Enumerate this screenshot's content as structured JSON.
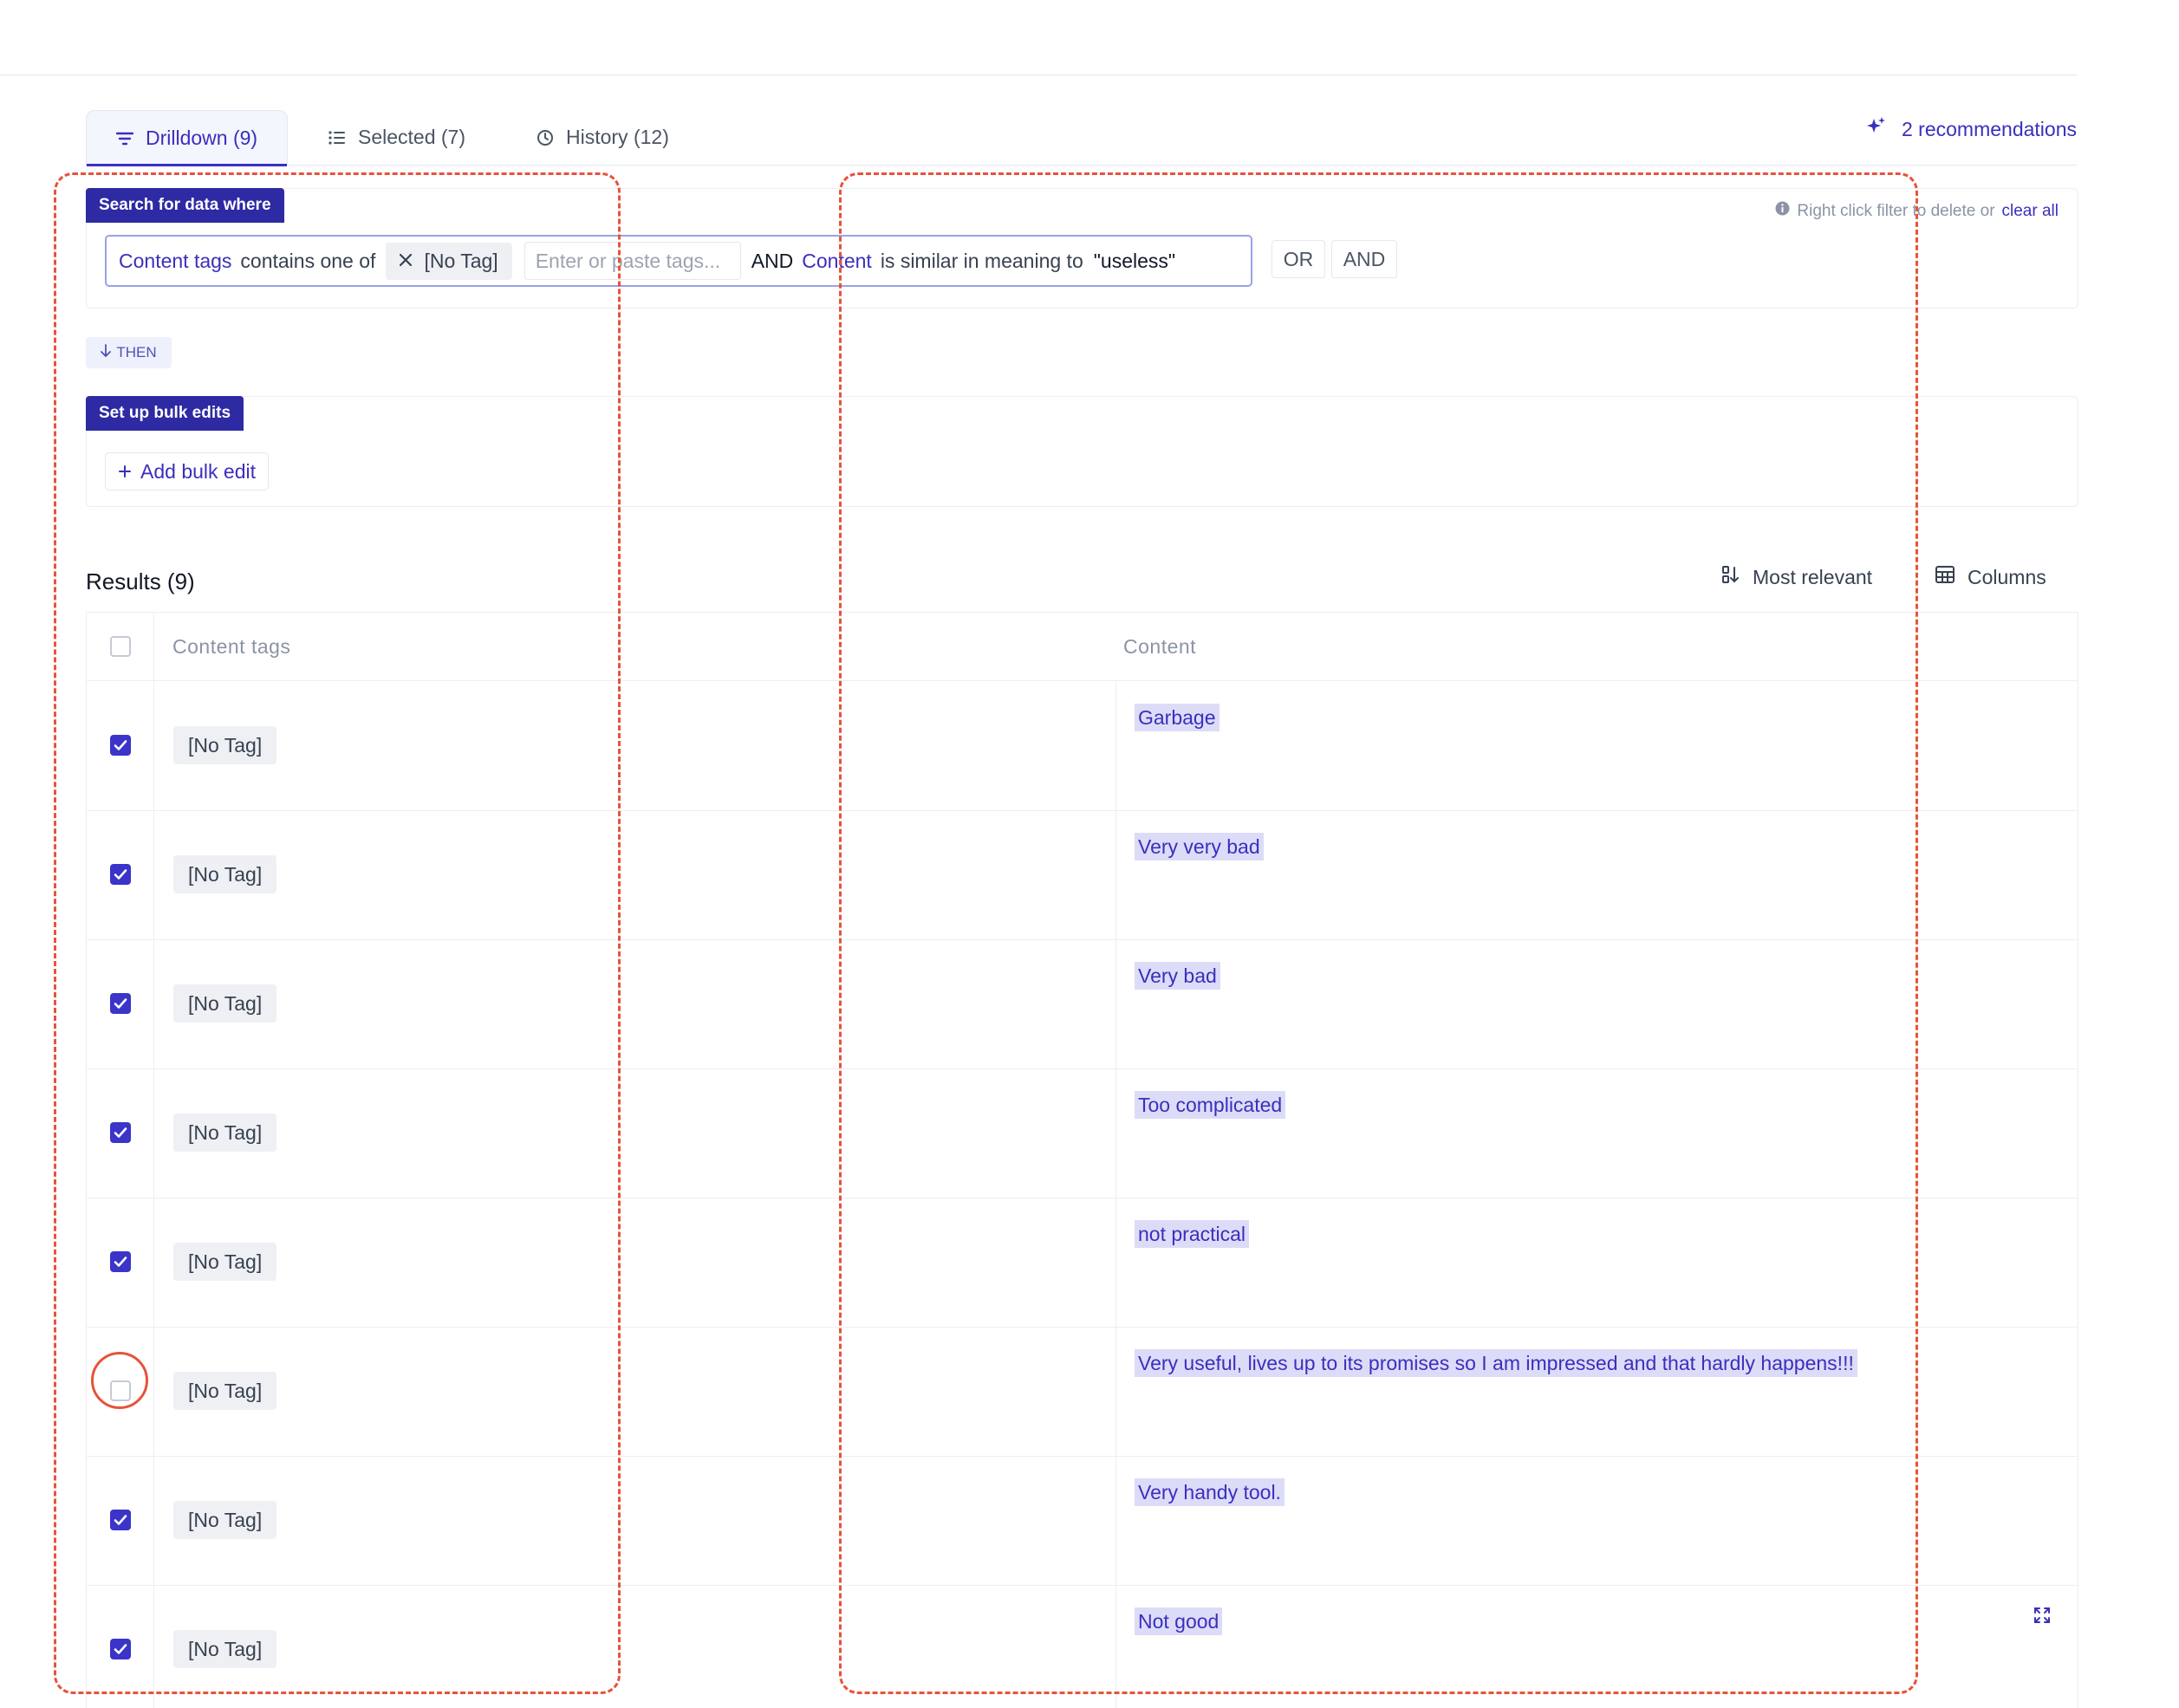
{
  "tabs": [
    {
      "label": "Drilldown (9)",
      "icon": "filter-icon",
      "active": true
    },
    {
      "label": "Selected (7)",
      "icon": "list-icon",
      "active": false
    },
    {
      "label": "History (12)",
      "icon": "clock-icon",
      "active": false
    }
  ],
  "recommendations": {
    "label": "2 recommendations",
    "icon": "sparkle-icon"
  },
  "search": {
    "section_label": "Search for data where",
    "hint_text": "Right click filter to delete or",
    "clear_all": "clear all",
    "filter1": {
      "field": "Content tags",
      "operator": "contains one of",
      "tag": "[No Tag]"
    },
    "input_placeholder": "Enter or paste tags...",
    "conjunction": "AND",
    "filter2": {
      "field": "Content",
      "operator": "is similar in meaning to",
      "value": "\"useless\""
    },
    "or_button": "OR",
    "and_button": "AND"
  },
  "then_label": "THEN",
  "bulk": {
    "section_label": "Set up bulk edits",
    "add_label": "Add bulk edit"
  },
  "results": {
    "title": "Results (9)",
    "sort_label": "Most relevant",
    "columns_label": "Columns",
    "headers": {
      "tags": "Content tags",
      "content": "Content"
    },
    "rows": [
      {
        "checked": true,
        "tag": "[No Tag]",
        "content": "Garbage"
      },
      {
        "checked": true,
        "tag": "[No Tag]",
        "content": "Very very bad"
      },
      {
        "checked": true,
        "tag": "[No Tag]",
        "content": "Very bad"
      },
      {
        "checked": true,
        "tag": "[No Tag]",
        "content": "Too complicated"
      },
      {
        "checked": true,
        "tag": "[No Tag]",
        "content": "not practical"
      },
      {
        "checked": false,
        "tag": "[No Tag]",
        "content": "Very useful, lives up to its promises so I am impressed and that hardly happens!!!"
      },
      {
        "checked": true,
        "tag": "[No Tag]",
        "content": "Very handy tool."
      },
      {
        "checked": true,
        "tag": "[No Tag]",
        "content": "Not good"
      }
    ]
  },
  "colors": {
    "accent": "#3b2fbd",
    "label_bg": "#2e2aa3",
    "annotation": "#e6533c",
    "highlight": "#dcdcf8"
  }
}
